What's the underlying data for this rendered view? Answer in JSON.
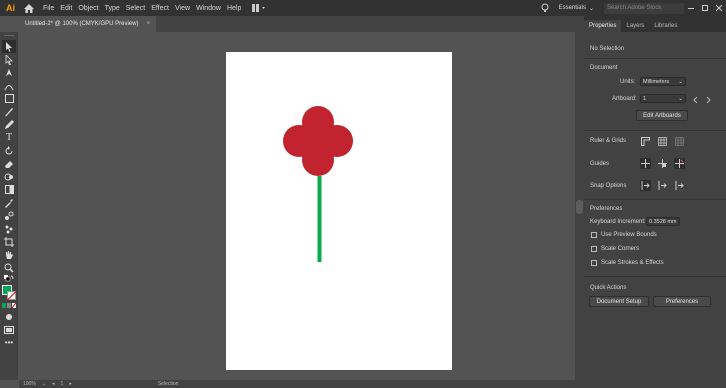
{
  "app": {
    "logo": "Ai"
  },
  "menu": [
    "File",
    "Edit",
    "Object",
    "Type",
    "Select",
    "Effect",
    "View",
    "Window",
    "Help"
  ],
  "workspace": {
    "label": "Essentials",
    "search_placeholder": "Search Adobe Stock"
  },
  "document": {
    "tab_title": "Untitled-2* @ 100% (CMYK/GPU Preview)",
    "close": "×"
  },
  "colors": {
    "fill": "#00a651",
    "petal": "#c1232f",
    "stem": "#0aaa4e",
    "accent": "#ff9a00"
  },
  "panel": {
    "tabs": [
      "Properties",
      "Layers",
      "Libraries"
    ],
    "no_selection": "No Selection",
    "document_label": "Document",
    "units_label": "Units:",
    "units_value": "Millimeters",
    "artboard_label": "Artboard:",
    "artboard_value": "1",
    "edit_artboards": "Edit Artboards",
    "rulers_grids": "Ruler & Grids",
    "guides": "Guides",
    "snap_options": "Snap Options",
    "preferences_label": "Preferences",
    "keyboard_increment_label": "Keyboard Increment:",
    "keyboard_increment_value": "0.3528 mm",
    "checkboxes": [
      "Use Preview Bounds",
      "Scale Corners",
      "Scale Strokes & Effects"
    ],
    "quick_actions": "Quick Actions",
    "document_setup": "Document Setup",
    "preferences_button": "Preferences"
  },
  "status": {
    "zoom": "100%",
    "artboard": "1",
    "tool": "Selection"
  }
}
